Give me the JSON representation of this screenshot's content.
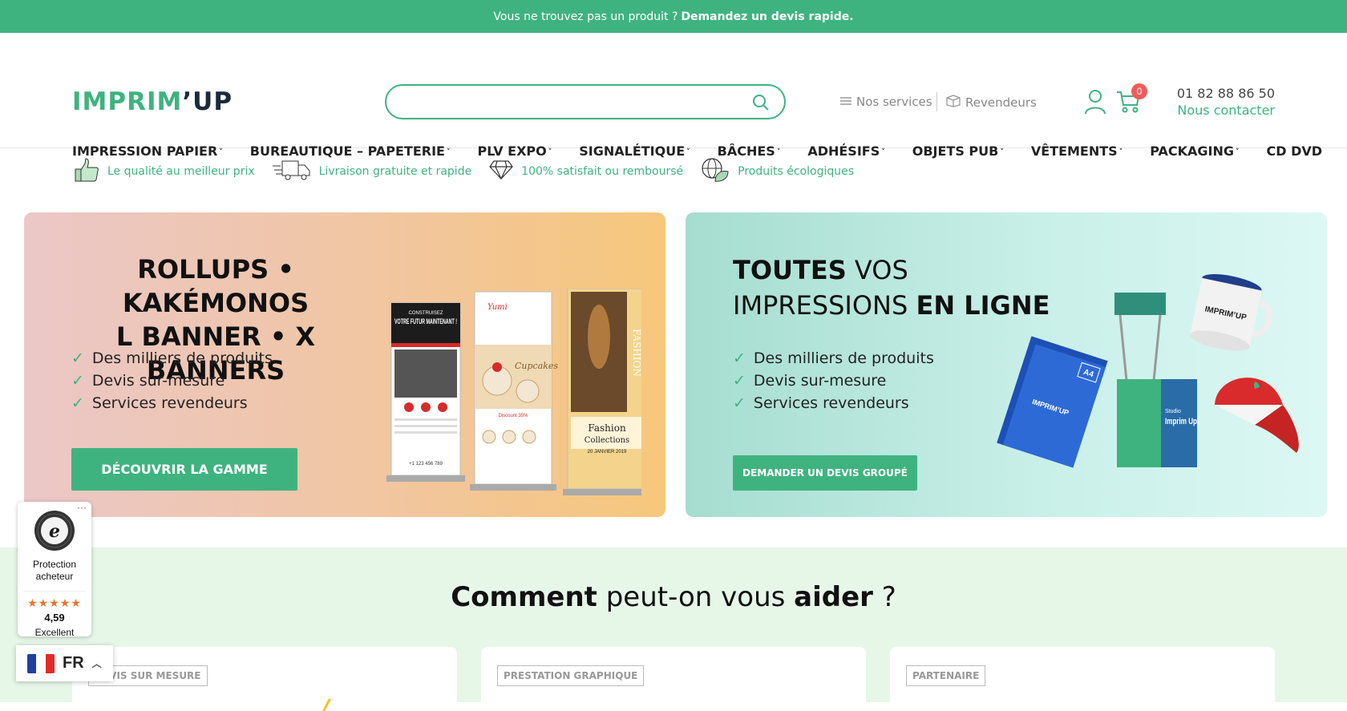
{
  "topbar": {
    "text": "Vous ne trouvez pas un produit ?",
    "link": "Demandez un devis rapide."
  },
  "logo": {
    "part1": "IMPRIM",
    "apostrophe": "’",
    "part2": "UP"
  },
  "search": {
    "placeholder": ""
  },
  "header_links": {
    "services": "Nos services",
    "resellers": "Revendeurs"
  },
  "cart": {
    "count": "0"
  },
  "contact": {
    "phone": "01 82 88 86 50",
    "label": "Nous contacter"
  },
  "nav": [
    {
      "label": "IMPRESSION PAPIER"
    },
    {
      "label": "BUREAUTIQUE – PAPETERIE"
    },
    {
      "label": "PLV EXPO"
    },
    {
      "label": "SIGNALÉTIQUE"
    },
    {
      "label": "BÂCHES"
    },
    {
      "label": "ADHÉSIFS"
    },
    {
      "label": "OBJETS PUB"
    },
    {
      "label": "VÊTEMENTS"
    },
    {
      "label": "PACKAGING"
    },
    {
      "label": "CD DVD"
    }
  ],
  "features": [
    {
      "label": "Le qualité au meilleur prix",
      "icon": "thumbs-up-icon"
    },
    {
      "label": "Livraison gratuite et rapide",
      "icon": "truck-icon"
    },
    {
      "label": "100% satisfait ou remboursé",
      "icon": "diamond-icon"
    },
    {
      "label": "Produits écologiques",
      "icon": "eco-globe-icon"
    }
  ],
  "banner1": {
    "line1": "ROLLUPS • KAKÉMONOS",
    "line2": "L BANNER • X BANNERS",
    "checks": [
      "Des milliers de produits",
      "Devis sur-mesure",
      "Services revendeurs"
    ],
    "button": "DÉCOUVRIR LA GAMME",
    "rollup1": {
      "top": "CONSTRUISEZ",
      "title": "VOTRE FUTUR MAINTENANT !",
      "phone": "+1 123 456 789"
    },
    "rollup2": {
      "title": "Yumi",
      "cake": "Cupcakes",
      "badge": "Discount 35%"
    },
    "rollup3": {
      "side": "FASHION",
      "title": "Fashion",
      "sub": "Collections",
      "date": "20 JANVIER 2019"
    }
  },
  "banner2": {
    "title_bold1": "TOUTES",
    "title_norm1": "VOS",
    "title_norm2": "IMPRESSIONS",
    "title_bold2": "EN LIGNE",
    "checks": [
      "Des milliers de produits",
      "Devis sur-mesure",
      "Services revendeurs"
    ],
    "button": "DEMANDER UN DEVIS GROUPÉ",
    "booklet": {
      "size": "A4",
      "brand": "IMPRIM’UP"
    },
    "mug": "IMPRIM’UP",
    "stand": {
      "small": "Studio",
      "brand": "Imprim Up"
    }
  },
  "help": {
    "bold1": "Comment",
    "middle": "peut-on vous",
    "bold2": "aider",
    "end": "?",
    "cards": [
      {
        "tag": "DEVIS SUR MESURE"
      },
      {
        "tag": "PRESTATION GRAPHIQUE"
      },
      {
        "tag": "PARTENAIRE"
      }
    ]
  },
  "trust": {
    "protection": "Protection acheteur",
    "stars": "★★★★★",
    "score": "4,59",
    "rating": "Excellent",
    "dots": "···"
  },
  "language": {
    "code": "FR"
  },
  "colors": {
    "brand_green": "#3fb37f",
    "badge_red": "#ee5c5c"
  }
}
